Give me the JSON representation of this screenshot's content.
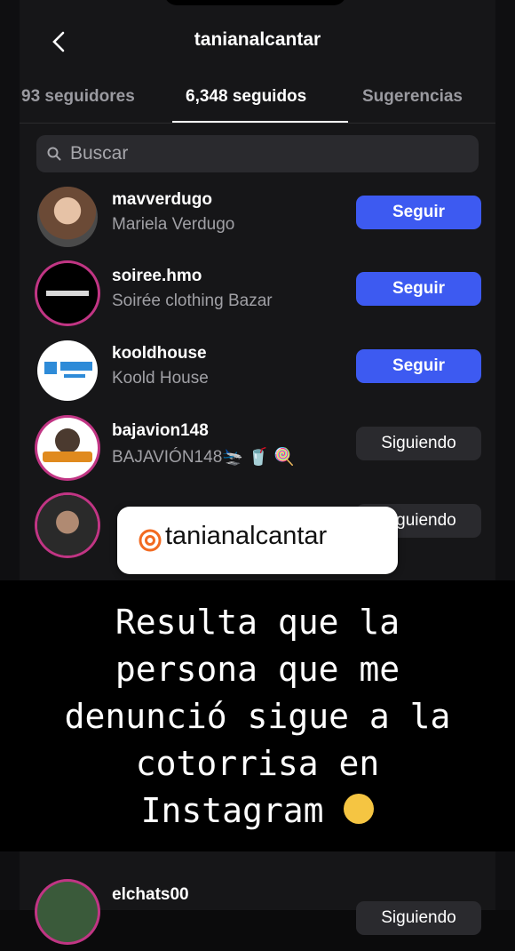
{
  "header": {
    "title": "tanianalcantar"
  },
  "tabs": [
    {
      "label": "93 seguidores"
    },
    {
      "label": "6,348 seguidos"
    },
    {
      "label": "Sugerencias"
    }
  ],
  "search": {
    "placeholder": "Buscar"
  },
  "rows": [
    {
      "handle": "mavverdugo",
      "name": "Mariela Verdugo",
      "button": "Seguir"
    },
    {
      "handle": "soiree.hmo",
      "name": "Soirée clothing Bazar",
      "button": "Seguir"
    },
    {
      "handle": "kooldhouse",
      "name": "Koold House",
      "button": "Seguir"
    },
    {
      "handle": "bajavion148",
      "name": "BAJAVIÓN148🛬 🥤 🍭",
      "button": "Siguiendo"
    },
    {
      "button": "Siguiendo"
    },
    {
      "handle": "elchats00",
      "button": "Siguiendo"
    }
  ],
  "mention_sticker": {
    "text": "tanianalcantar"
  },
  "caption": {
    "line1": "Resulta que la",
    "line2": "persona que me",
    "line3": "denunció sigue a la",
    "line4": "cotorrisa en",
    "line5": "Instagram"
  },
  "colors": {
    "follow_blue": "#3d5af1",
    "background": "#161618"
  },
  "icons": {
    "back": "chevron-left-icon",
    "search": "search-icon",
    "mention": "threads-at-icon"
  }
}
